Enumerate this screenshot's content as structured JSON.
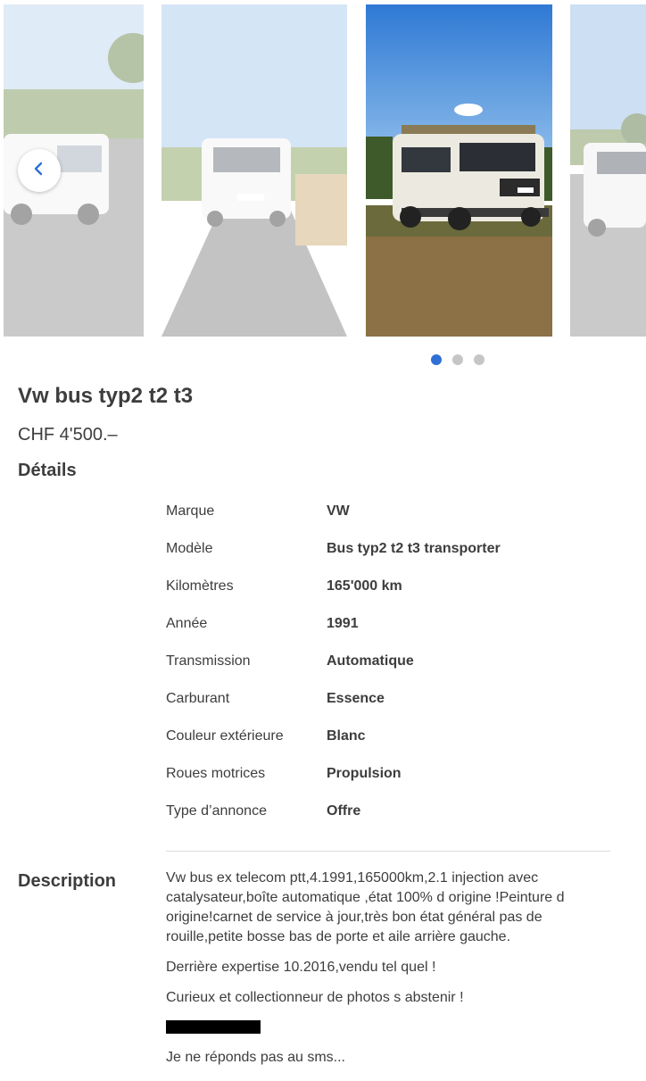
{
  "gallery": {
    "photos": [
      {
        "name": "photo-van-side-road"
      },
      {
        "name": "photo-van-rear-road"
      },
      {
        "name": "photo-van-front-field"
      },
      {
        "name": "photo-van-front-partial"
      }
    ],
    "prev_icon": "chevron-left-icon",
    "pagination": {
      "count": 3,
      "active": 0
    },
    "accent_color": "#2f6fd6"
  },
  "listing": {
    "title": "Vw bus typ2 t2 t3",
    "price": "CHF 4'500.–",
    "details_heading": "Détails",
    "details": [
      {
        "label": "Marque",
        "value": "VW"
      },
      {
        "label": "Modèle",
        "value": "Bus typ2 t2 t3 transporter"
      },
      {
        "label": "Kilomètres",
        "value": "165'000 km"
      },
      {
        "label": "Année",
        "value": "1991"
      },
      {
        "label": "Transmission",
        "value": "Automatique"
      },
      {
        "label": "Carburant",
        "value": "Essence"
      },
      {
        "label": "Couleur extérieure",
        "value": "Blanc"
      },
      {
        "label": "Roues motrices",
        "value": "Propulsion"
      },
      {
        "label": "Type d’annonce",
        "value": "Offre"
      }
    ],
    "description_heading": "Description",
    "description": [
      "Vw bus ex telecom ptt,4.1991,165000km,2.1 injection avec catalysateur,boîte automatique ,état 100% d origine !Peinture d origine!carnet de service à jour,très bon état général pas de rouille,petite bosse bas de porte et aile arrière gauche.",
      "Derrière expertise 10.2016,vendu tel quel !",
      "Curieux et collectionneur de photos s abstenir !"
    ],
    "description_footer": "Je ne réponds pas au sms..."
  }
}
